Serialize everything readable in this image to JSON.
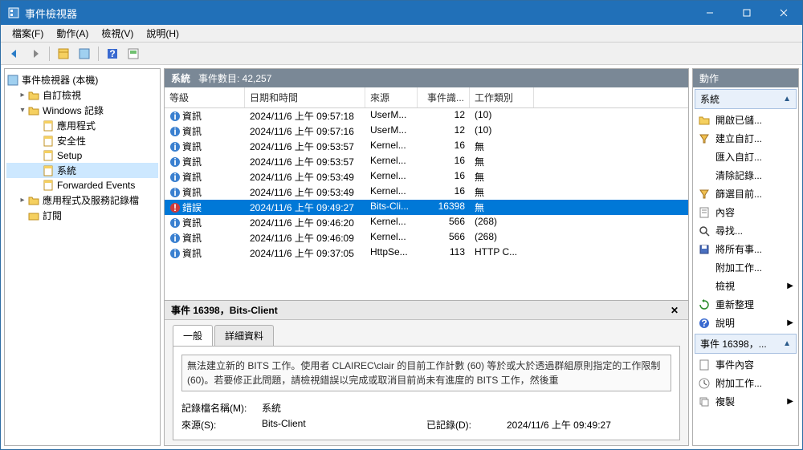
{
  "titlebar": {
    "title": "事件檢視器"
  },
  "menu": {
    "file": "檔案(F)",
    "action": "動作(A)",
    "view": "檢視(V)",
    "help": "說明(H)"
  },
  "tree": {
    "root": "事件檢視器 (本機)",
    "custom": "自訂檢視",
    "winlogs": "Windows 記錄",
    "application": "應用程式",
    "security": "安全性",
    "setup": "Setup",
    "system": "系統",
    "forwarded": "Forwarded Events",
    "appservices": "應用程式及服務記錄檔",
    "subscriptions": "訂閱"
  },
  "center": {
    "heading": "系統",
    "count_label": "事件數目: 42,257",
    "columns": {
      "level": "等級",
      "date": "日期和時間",
      "source": "來源",
      "id": "事件識...",
      "category": "工作類別"
    },
    "rows": [
      {
        "level": "資訊",
        "date": "2024/11/6 上午 09:57:18",
        "source": "UserM...",
        "id": "12",
        "category": "(10)",
        "kind": "info"
      },
      {
        "level": "資訊",
        "date": "2024/11/6 上午 09:57:16",
        "source": "UserM...",
        "id": "12",
        "category": "(10)",
        "kind": "info"
      },
      {
        "level": "資訊",
        "date": "2024/11/6 上午 09:53:57",
        "source": "Kernel...",
        "id": "16",
        "category": "無",
        "kind": "info"
      },
      {
        "level": "資訊",
        "date": "2024/11/6 上午 09:53:57",
        "source": "Kernel...",
        "id": "16",
        "category": "無",
        "kind": "info"
      },
      {
        "level": "資訊",
        "date": "2024/11/6 上午 09:53:49",
        "source": "Kernel...",
        "id": "16",
        "category": "無",
        "kind": "info"
      },
      {
        "level": "資訊",
        "date": "2024/11/6 上午 09:53:49",
        "source": "Kernel...",
        "id": "16",
        "category": "無",
        "kind": "info"
      },
      {
        "level": "錯誤",
        "date": "2024/11/6 上午 09:49:27",
        "source": "Bits-Cli...",
        "id": "16398",
        "category": "無",
        "kind": "error",
        "selected": true
      },
      {
        "level": "資訊",
        "date": "2024/11/6 上午 09:46:20",
        "source": "Kernel...",
        "id": "566",
        "category": "(268)",
        "kind": "info"
      },
      {
        "level": "資訊",
        "date": "2024/11/6 上午 09:46:09",
        "source": "Kernel...",
        "id": "566",
        "category": "(268)",
        "kind": "info"
      },
      {
        "level": "資訊",
        "date": "2024/11/6 上午 09:37:05",
        "source": "HttpSe...",
        "id": "113",
        "category": "HTTP C...",
        "kind": "info"
      }
    ]
  },
  "detail": {
    "title": "事件 16398，Bits-Client",
    "tab_general": "一般",
    "tab_details": "詳細資料",
    "message": "無法建立新的 BITS 工作。使用者 CLAIREC\\clair 的目前工作計數 (60) 等於或大於透過群組原則指定的工作限制 (60)。若要修正此問題，請檢視錯誤以完成或取消目前尚未有進度的 BITS 工作，然後重",
    "fields": {
      "logname_label": "記錄檔名稱(M):",
      "logname": "系統",
      "source_label": "來源(S):",
      "source": "Bits-Client",
      "logged_label": "已記錄(D):",
      "logged": "2024/11/6 上午 09:49:27"
    }
  },
  "actions": {
    "header": "動作",
    "group1_title": "系統",
    "open_saved": "開啟已儲...",
    "create_custom": "建立自訂...",
    "import_custom": "匯入自訂...",
    "clear_log": "清除記錄...",
    "filter_current": "篩選目前...",
    "properties": "內容",
    "find": "尋找...",
    "save_all": "將所有事...",
    "attach_task": "附加工作...",
    "view": "檢視",
    "refresh": "重新整理",
    "help": "說明",
    "group2_title": "事件 16398，...",
    "event_props": "事件內容",
    "attach_task2": "附加工作...",
    "copy": "複製"
  }
}
